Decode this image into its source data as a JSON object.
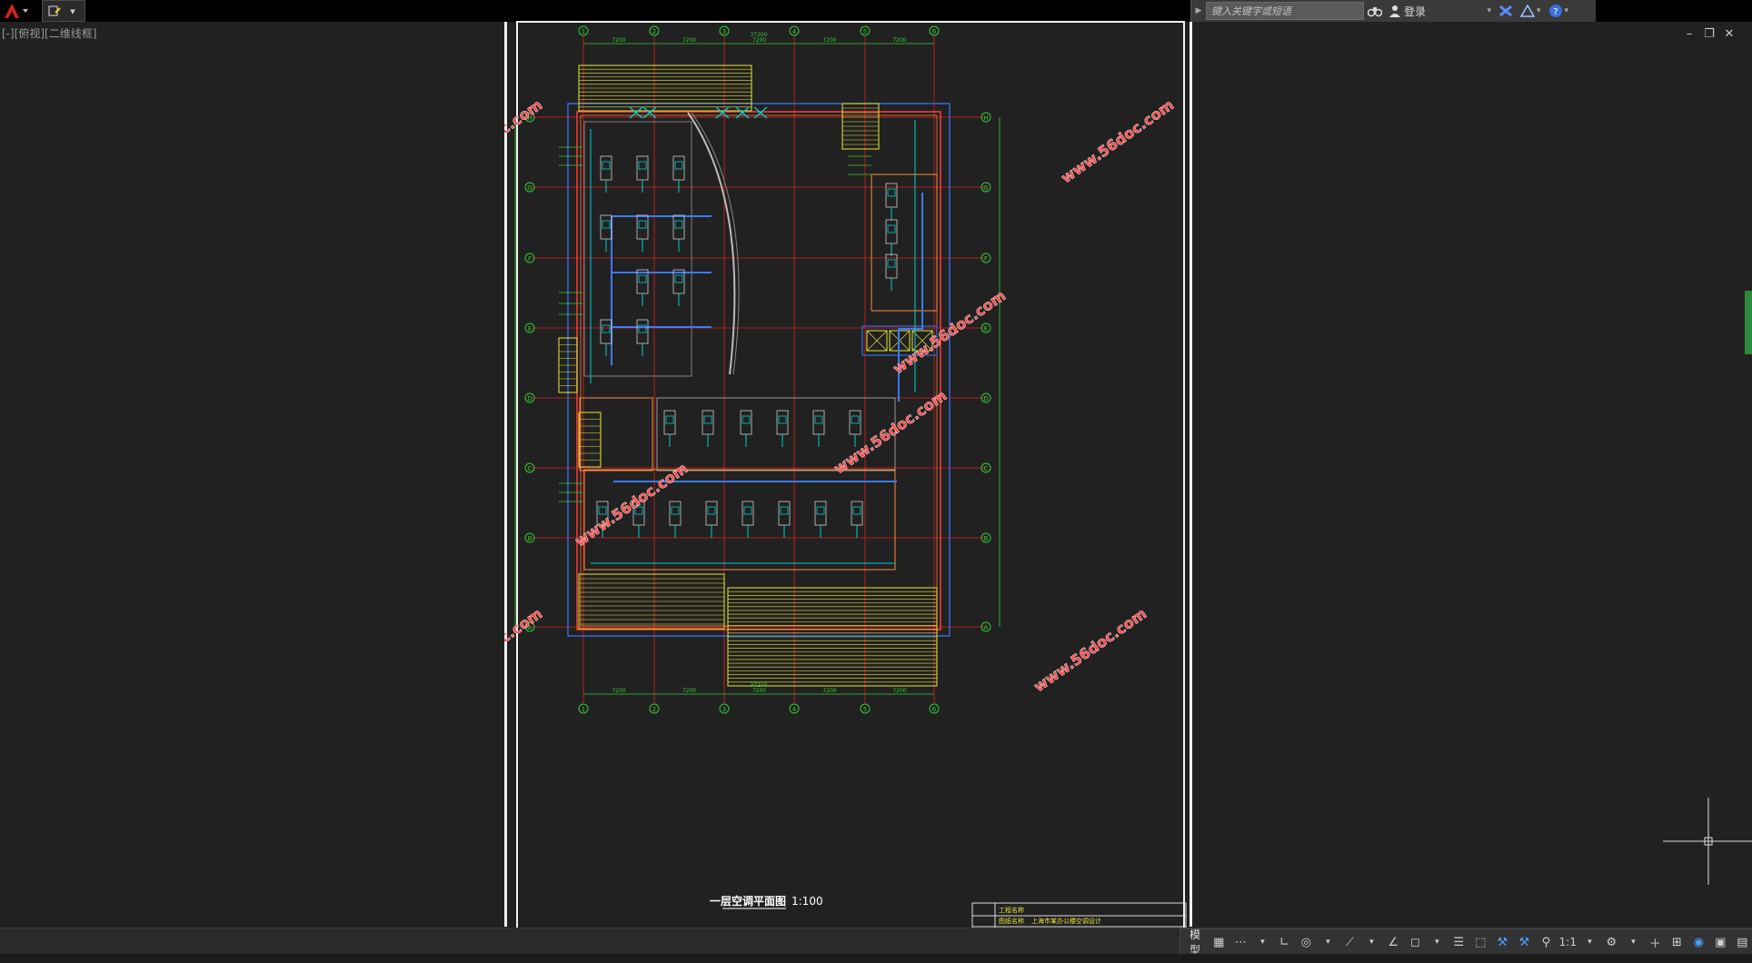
{
  "app": {
    "viewport_label": "[-][俯视][二维线框]"
  },
  "infocenter": {
    "search_placeholder": "键入关键字或短语",
    "login_label": "登录"
  },
  "drawing": {
    "title": "一层空调平面图",
    "scale": "1:100",
    "watermark": "www.56doc.com",
    "column_axes": [
      "1",
      "2",
      "3",
      "4",
      "5",
      "6"
    ],
    "row_axes": [
      "H",
      "G",
      "F",
      "E",
      "D",
      "C",
      "B",
      "A"
    ],
    "top_dimensions": [
      "7200",
      "7200",
      "7200",
      "7200",
      "7200"
    ],
    "overall_dimension": "37200",
    "titleblock_lines": [
      "工程名称",
      "图纸名称",
      "上海市某办公楼空调设计"
    ]
  },
  "statusbar": {
    "model_label": "模型",
    "scale_label": "1:1"
  },
  "colors": {
    "background": "#212121",
    "wall": "#ff3b3b",
    "grid": "#e02020",
    "stair": "#e8e83a",
    "dim": "#33cc33",
    "duct_blue": "#3a7bff",
    "pipe_cyan": "#00d0d0",
    "watermark": "#ff4a4a"
  }
}
